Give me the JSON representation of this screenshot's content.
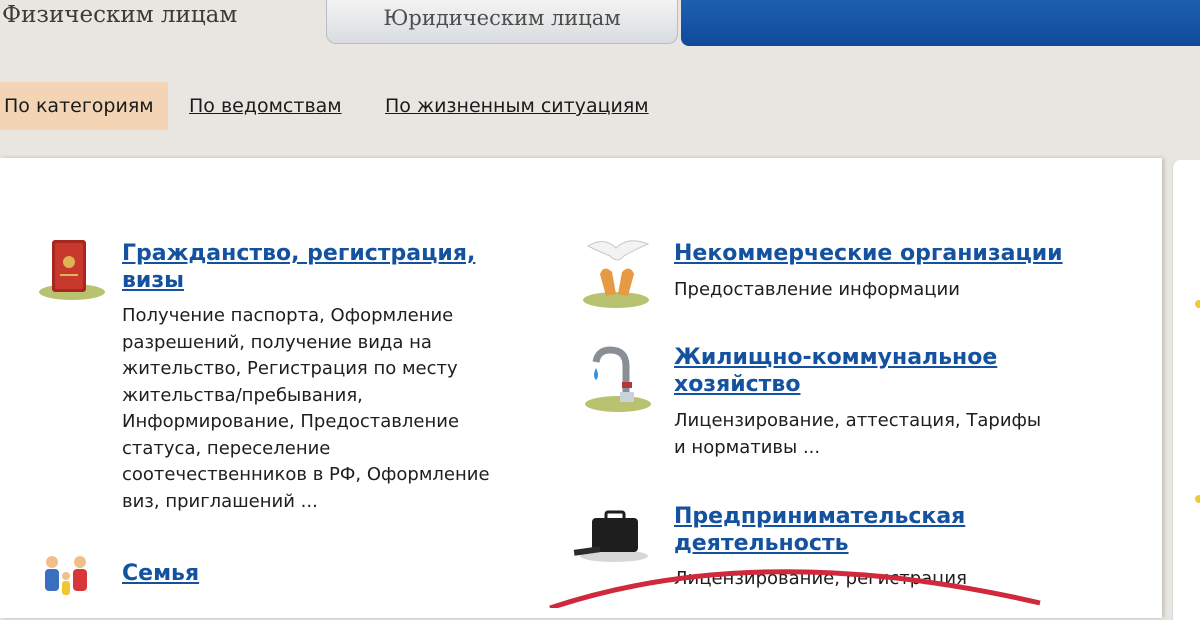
{
  "tabs": {
    "individuals": "Физическим лицам",
    "legal_entities": "Юридическим лицам"
  },
  "filter_nav": {
    "by_category": "По категориям",
    "by_agency": "По ведомствам",
    "by_life_situation": "По жизненным ситуациям"
  },
  "categories": {
    "citizenship": {
      "title_line1": "Гражданство, регистрация,",
      "title_line2": "визы",
      "desc_lines": [
        "Получение паспорта, Оформление",
        "разрешений, получение вида на",
        "жительство, Регистрация по месту",
        "жительства/пребывания,",
        "Информирование, Предоставление",
        "статуса, переселение",
        "соотечественников в РФ, Оформление",
        "виз, приглашений ..."
      ],
      "icon": "passport-icon"
    },
    "family": {
      "title": "Семья",
      "icon": "family-icon"
    },
    "nonprofit": {
      "title": "Некоммерческие организации",
      "desc_lines": [
        "Предоставление информации"
      ],
      "icon": "dove-hands-icon"
    },
    "housing": {
      "title_line1": "Жилищно-коммунальное",
      "title_line2": "хозяйство",
      "desc_lines": [
        "Лицензирование, аттестация, Тарифы",
        "и нормативы ..."
      ],
      "icon": "faucet-icon"
    },
    "business": {
      "title_line1": "Предпринимательская",
      "title_line2": "деятельность",
      "desc_lines": [
        "Лицензирование, регистрация"
      ],
      "icon": "briefcase-icon"
    }
  },
  "colors": {
    "link": "#1452a0",
    "active_filter_bg": "#f3d5b5",
    "banner_blue": "#0e4a9c",
    "annotation_red": "#d0283c"
  }
}
